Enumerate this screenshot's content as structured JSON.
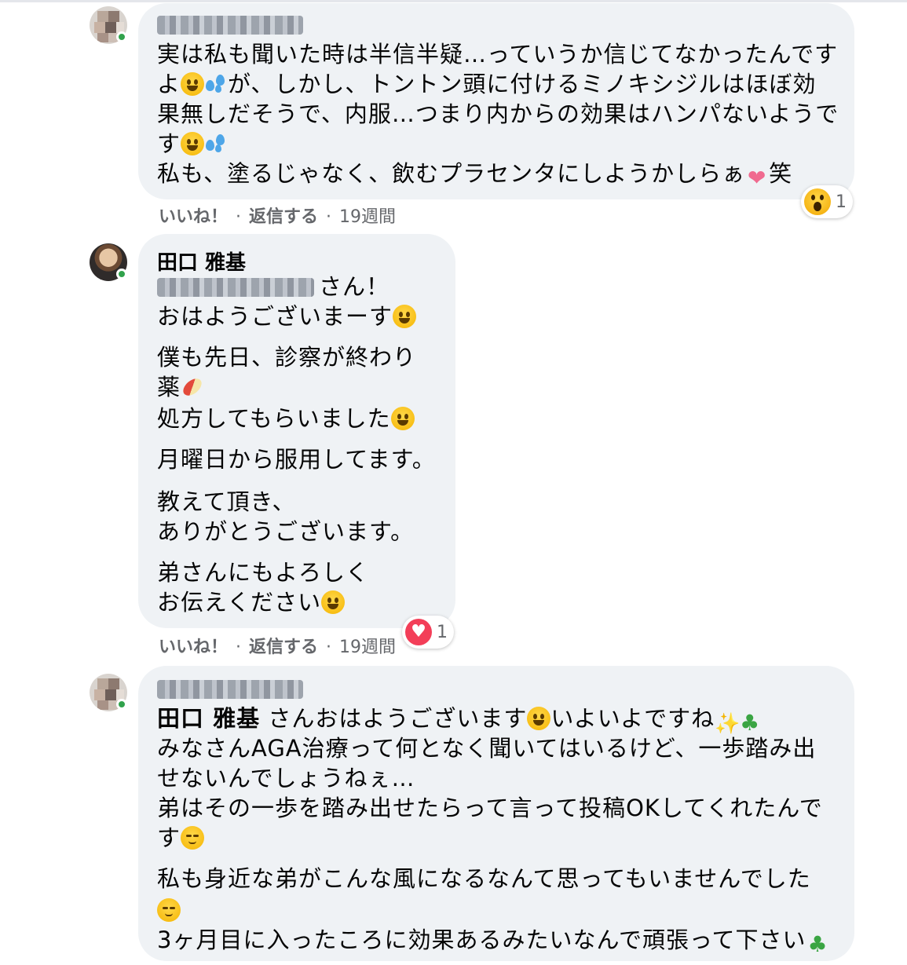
{
  "comments": [
    {
      "author": "",
      "lines": [
        "実は私も聞いた時は半信半疑…っていうか信じてなかったんです",
        "が、しかし、トントン頭に付けるミノキシジルはほぼ効",
        "果無しだそうで、内服…つまり内からの効果はハンパないようで",
        "私も、塗るじゃなく、飲むプラセンタにしようかしらぁ",
        "笑"
      ],
      "line2_prefix": "よ",
      "line4_prefix": "す",
      "like": "いいね！",
      "reply": "返信する",
      "time": "19週間",
      "reaction_count": "1",
      "reaction_icon": "wow-reaction-icon"
    },
    {
      "author": "田口 雅基",
      "mention_suffix": "さん！",
      "lines": [
        "おはようございまーす",
        "僕も先日、診察が終わり",
        "薬",
        "処方してもらいました",
        "月曜日から服用してます。",
        "教えて頂き、",
        "ありがとうございます。",
        "弟さんにもよろしく",
        "お伝えください"
      ],
      "like": "いいね！",
      "reply": "返信する",
      "time": "19週間",
      "reaction_count": "1",
      "reaction_icon": "love-reaction-icon"
    },
    {
      "author": "",
      "mention": "田口 雅基",
      "line1_a": "さんおはようございます",
      "line1_b": "いよいよですね",
      "lines": [
        "みなさんAGA治療って何となく聞いてはいるけど、一歩踏み出",
        "せないんでしょうねぇ…",
        "弟はその一歩を踏み出せたらって言って投稿OKしてくれたんで",
        "す",
        "私も身近な弟がこんな風になるなんて思ってもいませんでした",
        "3ヶ月目に入ったころに効果あるみたいなんで頑張って下さい"
      ]
    }
  ],
  "colors": {
    "bubble": "#eff2f5",
    "meta_text": "#65676b",
    "online": "#31a24c",
    "love": "#f33e58"
  }
}
